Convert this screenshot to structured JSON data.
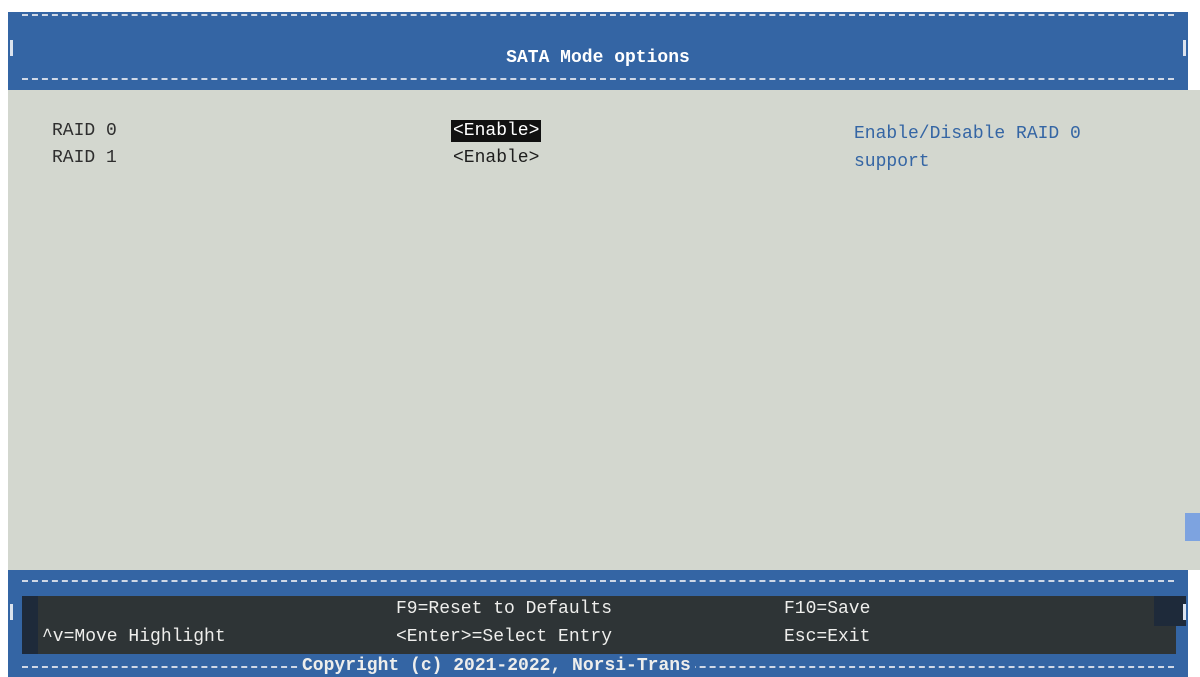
{
  "header": {
    "title": "SATA Mode options"
  },
  "options": [
    {
      "label": "RAID 0",
      "value": "<Enable>"
    },
    {
      "label": "RAID 1",
      "value": "<Enable>"
    }
  ],
  "help": {
    "line1": "Enable/Disable RAID 0",
    "line2": "support"
  },
  "footer": {
    "reset": "F9=Reset to Defaults",
    "save": "F10=Save",
    "move": "^v=Move Highlight",
    "select": "<Enter>=Select Entry",
    "exit": "Esc=Exit",
    "copyright": "Copyright (c) 2021-2022, Norsi-Trans"
  },
  "colors": {
    "frame": "#3465a4",
    "background": "#d3d7cf",
    "help_text": "#3465a4",
    "selection": "#111111"
  }
}
